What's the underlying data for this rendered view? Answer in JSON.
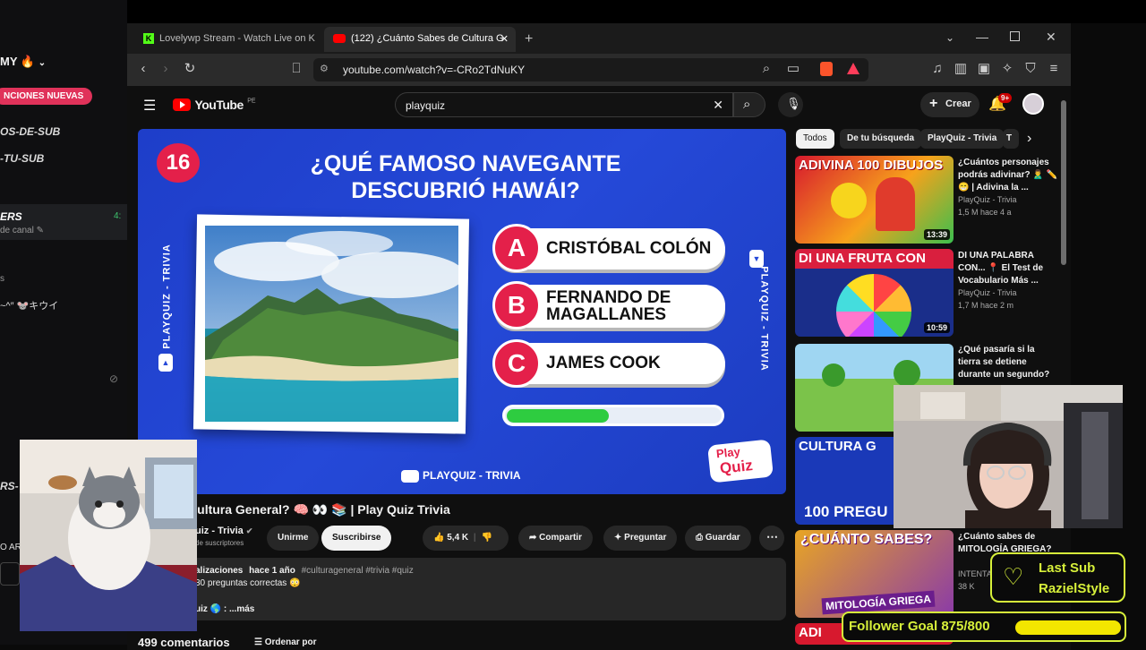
{
  "chat": {
    "user": "MY",
    "pill": "NCIONES NUEVAS",
    "cmd1": "OS-DE-SUB",
    "cmd2": "-TU-SUB",
    "highlight_name": "ERS",
    "highlight_time": "4:",
    "highlight_sub": "de canal",
    "line_s": "s",
    "line_kana": "~^″  🐭キウイ",
    "cmd3": "RS-",
    "side_o": "O AR"
  },
  "browser": {
    "tab1_label": "Lovelywp Stream - Watch Live on Kic",
    "tab2_label": "(122) ¿Cuánto Sabes de Cultura G",
    "new_tab": "+",
    "url": "youtube.com/watch?v=-CRo2TdNuKY"
  },
  "youtube": {
    "logo_text": "YouTube",
    "logo_region": "PE",
    "search_value": "playquiz",
    "create_label": "Crear",
    "notification_count": "9+",
    "chips": [
      "Todos",
      "De tu búsqueda",
      "PlayQuiz - Trivia",
      "T"
    ]
  },
  "video": {
    "question_number": "16",
    "question": "¿QUÉ FAMOSO NAVEGANTE DESCUBRIÓ HAWÁI?",
    "answers": [
      {
        "letter": "A",
        "text": "CRISTÓBAL COLÓN"
      },
      {
        "letter": "B",
        "text": "FERNANDO DE MAGALLANES"
      },
      {
        "letter": "C",
        "text": "JAMES COOK"
      }
    ],
    "timer_progress": 0.48,
    "side_label": "PLAYQUIZ - TRIVIA",
    "channel_label": "PLAYQUIZ - TRIVIA",
    "logo_line1": "Play",
    "logo_line2": "Quiz"
  },
  "info": {
    "title": "abes de Cultura General? 🧠 👀 📚 | Play Quiz Trivia",
    "channel": "uiz - Trivia",
    "subs": "de suscriptores",
    "join_label": "Unirme",
    "subscribe_label": "Suscribirse",
    "likes": "5,4 K",
    "share_label": "Compartir",
    "ask_label": "Preguntar",
    "save_label": "Guardar",
    "desc_line1_views": "alizaciones",
    "desc_line1_date": "hace 1 año",
    "desc_line1_tags": "#culturageneral #trivia #quiz",
    "desc_line2": "30 preguntas correctas 😳",
    "desc_line3": "uiz 🌎 :  ...más",
    "comments": "499 comentarios",
    "sort_label": "Ordenar por"
  },
  "recommendations": [
    {
      "thumb_text": "ADIVINA 100 DIBUJOS",
      "duration": "13:39",
      "title": "¿Cuántos personajes podrás adivinar? 🙎‍♂️ ✏️😁 | Adivina la ...",
      "channel": "PlayQuiz - Trivia",
      "meta": "1,5 M  hace 4 a"
    },
    {
      "thumb_text": "DI UNA FRUTA CON",
      "duration": "10:59",
      "title": "DI UNA PALABRA CON... 📍 El Test de Vocabulario Más ...",
      "channel": "PlayQuiz - Trivia",
      "meta": "1,7 M  hace 2 m"
    },
    {
      "thumb_text": "",
      "duration": "",
      "title": "¿Qué pasaría si la tierra se detiene durante un segundo?",
      "channel": "",
      "meta": ""
    },
    {
      "thumb_text": "CULTURA G",
      "duration": "",
      "title": "",
      "channel": "",
      "meta": "",
      "bottom_text": "100 PREGU"
    },
    {
      "thumb_text": "¿CUÁNTO SABES?",
      "duration": "",
      "title": "¿Cuánto sabes de MITOLOGÍA GRIEGA?",
      "channel": "INTENTA",
      "meta": "38 K",
      "bottom_text": "MITOLOGÍA GRIEGA"
    },
    {
      "thumb_text": "ADI",
      "duration": "",
      "title": "",
      "channel": "",
      "meta": ""
    }
  ],
  "overlays": {
    "last_sub_title": "Last Sub",
    "last_sub_name": "RazielStyle",
    "follower_goal": "Follower Goal 875/800",
    "follower_progress": 1.0
  },
  "colors": {
    "accent_red": "#e4204a",
    "video_blue": "#2549d8",
    "overlay_lime": "#d7f03a",
    "timer_green": "#2ecc40"
  }
}
